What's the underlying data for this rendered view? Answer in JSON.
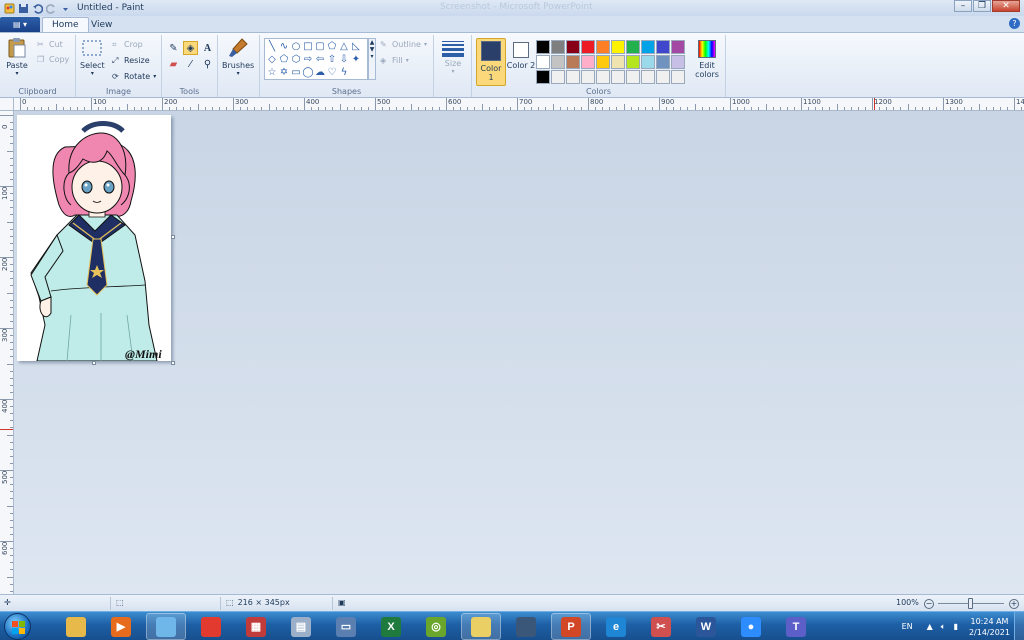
{
  "window": {
    "title": "Untitled - Paint",
    "center_title": "Screenshot - Microsoft PowerPoint"
  },
  "tabs": [
    {
      "label": "Home",
      "active": true
    },
    {
      "label": "View",
      "active": false
    }
  ],
  "ribbon": {
    "clipboard": {
      "paste": "Paste",
      "cut": "Cut",
      "copy": "Copy",
      "label": "Clipboard"
    },
    "image": {
      "select": "Select",
      "crop": "Crop",
      "resize": "Resize",
      "rotate": "Rotate",
      "label": "Image"
    },
    "tools": {
      "label": "Tools",
      "brushes": "Brushes"
    },
    "shapes": {
      "outline": "Outline",
      "fill": "Fill",
      "label": "Shapes"
    },
    "size": {
      "label": "Size"
    },
    "colors": {
      "color1_label": "Color 1",
      "color2_label": "Color 2",
      "edit_colors": "Edit colors",
      "label": "Colors",
      "color1": "#2b3f6b",
      "color2": "#ffffff",
      "palette": [
        "#000000",
        "#7f7f7f",
        "#880015",
        "#ed1c24",
        "#ff7f27",
        "#fff200",
        "#22b14c",
        "#00a2e8",
        "#3f48cc",
        "#a349a4",
        "#ffffff",
        "#c3c3c3",
        "#b97a57",
        "#ffaec9",
        "#ffc90e",
        "#efe4b0",
        "#b5e61d",
        "#99d9ea",
        "#7092be",
        "#c8bfe7",
        "#000000",
        "#f0f0f0",
        "#f0f0f0",
        "#f0f0f0",
        "#f0f0f0",
        "#f0f0f0",
        "#f0f0f0",
        "#f0f0f0",
        "#f0f0f0",
        "#f0f0f0"
      ]
    }
  },
  "ruler": {
    "h_labels": [
      "0",
      "100",
      "200",
      "300",
      "400",
      "500",
      "600",
      "700",
      "800",
      "900",
      "1000",
      "1100",
      "1200",
      "1300",
      "14"
    ],
    "v_labels": [
      "0",
      "100",
      "200",
      "300",
      "400",
      "500",
      "600"
    ]
  },
  "canvas": {
    "signature": "@Mimi"
  },
  "status": {
    "image_size": "216 × 345px",
    "zoom": "100%"
  },
  "taskbar": {
    "language": "EN",
    "time": "10:24 AM",
    "date": "2/14/2021",
    "apps": [
      {
        "name": "file-explorer-icon",
        "glyph": "",
        "color": "#e7b84a"
      },
      {
        "name": "media-player-icon",
        "glyph": "▶",
        "color": "#e66b1c"
      },
      {
        "name": "paint-icon",
        "glyph": "",
        "color": "#6fb7e8"
      },
      {
        "name": "chrome-icon",
        "glyph": "",
        "color": "#e23a2e"
      },
      {
        "name": "app-icon",
        "glyph": "▦",
        "color": "#c23b3b"
      },
      {
        "name": "calculator-icon",
        "glyph": "▤",
        "color": "#9bb0c8"
      },
      {
        "name": "scanner-icon",
        "glyph": "▭",
        "color": "#5a7fb0"
      },
      {
        "name": "excel-icon",
        "glyph": "X",
        "color": "#1f7a3e"
      },
      {
        "name": "greenshot-icon",
        "glyph": "◎",
        "color": "#6aa62c"
      },
      {
        "name": "folder-icon",
        "glyph": "",
        "color": "#e9cf64"
      },
      {
        "name": "microphone-icon",
        "glyph": "",
        "color": "#3a5678"
      },
      {
        "name": "powerpoint-icon",
        "glyph": "P",
        "color": "#d24726"
      },
      {
        "name": "internet-explorer-icon",
        "glyph": "e",
        "color": "#1f86d6"
      },
      {
        "name": "snipping-icon",
        "glyph": "✂",
        "color": "#d05050"
      },
      {
        "name": "word-icon",
        "glyph": "W",
        "color": "#2b579a"
      },
      {
        "name": "zoom-icon",
        "glyph": "●",
        "color": "#2d8cff"
      },
      {
        "name": "teams-icon",
        "glyph": "T",
        "color": "#5b5fc7"
      }
    ]
  }
}
